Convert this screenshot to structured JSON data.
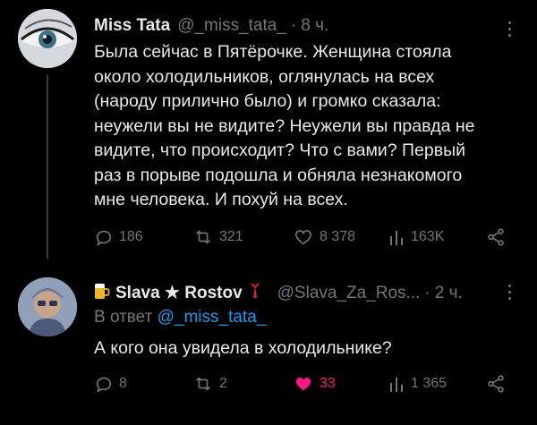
{
  "tweet1": {
    "name": "Miss Tata",
    "handle": "@_miss_tata_",
    "dot": "·",
    "time": "8 ч.",
    "text_lines": [
      "Была сейчас в Пятёрочке. Женщина стояла",
      "около холодильников, оглянулась на всех",
      "(народу прилично было) и громко сказала:",
      "неужели вы не видите? Неужели вы правда не",
      "видите, что происходит? Что с вами? Первый",
      "раз  в порыве подошла и обняла незнакомого",
      "мне человека. И похуй на всех."
    ],
    "actions": {
      "replies": "186",
      "retweets": "321",
      "likes": "8 378",
      "views": "163K"
    }
  },
  "tweet2": {
    "name": "Slava ★ Rostov",
    "handle": "@Slava_Za_Ros...",
    "dot": "·",
    "time": "2 ч.",
    "reply_prefix": "В ответ ",
    "reply_mention": "@_miss_tata_",
    "text": "А кого она увидела в холодильнике?",
    "actions": {
      "replies": "8",
      "retweets": "2",
      "likes": "33",
      "views": "1 365"
    }
  },
  "colors": {
    "background": "#000000",
    "text": "#e7e9ea",
    "muted": "#71767b",
    "mention": "#1d9bf0",
    "like_active": "#f91880"
  }
}
